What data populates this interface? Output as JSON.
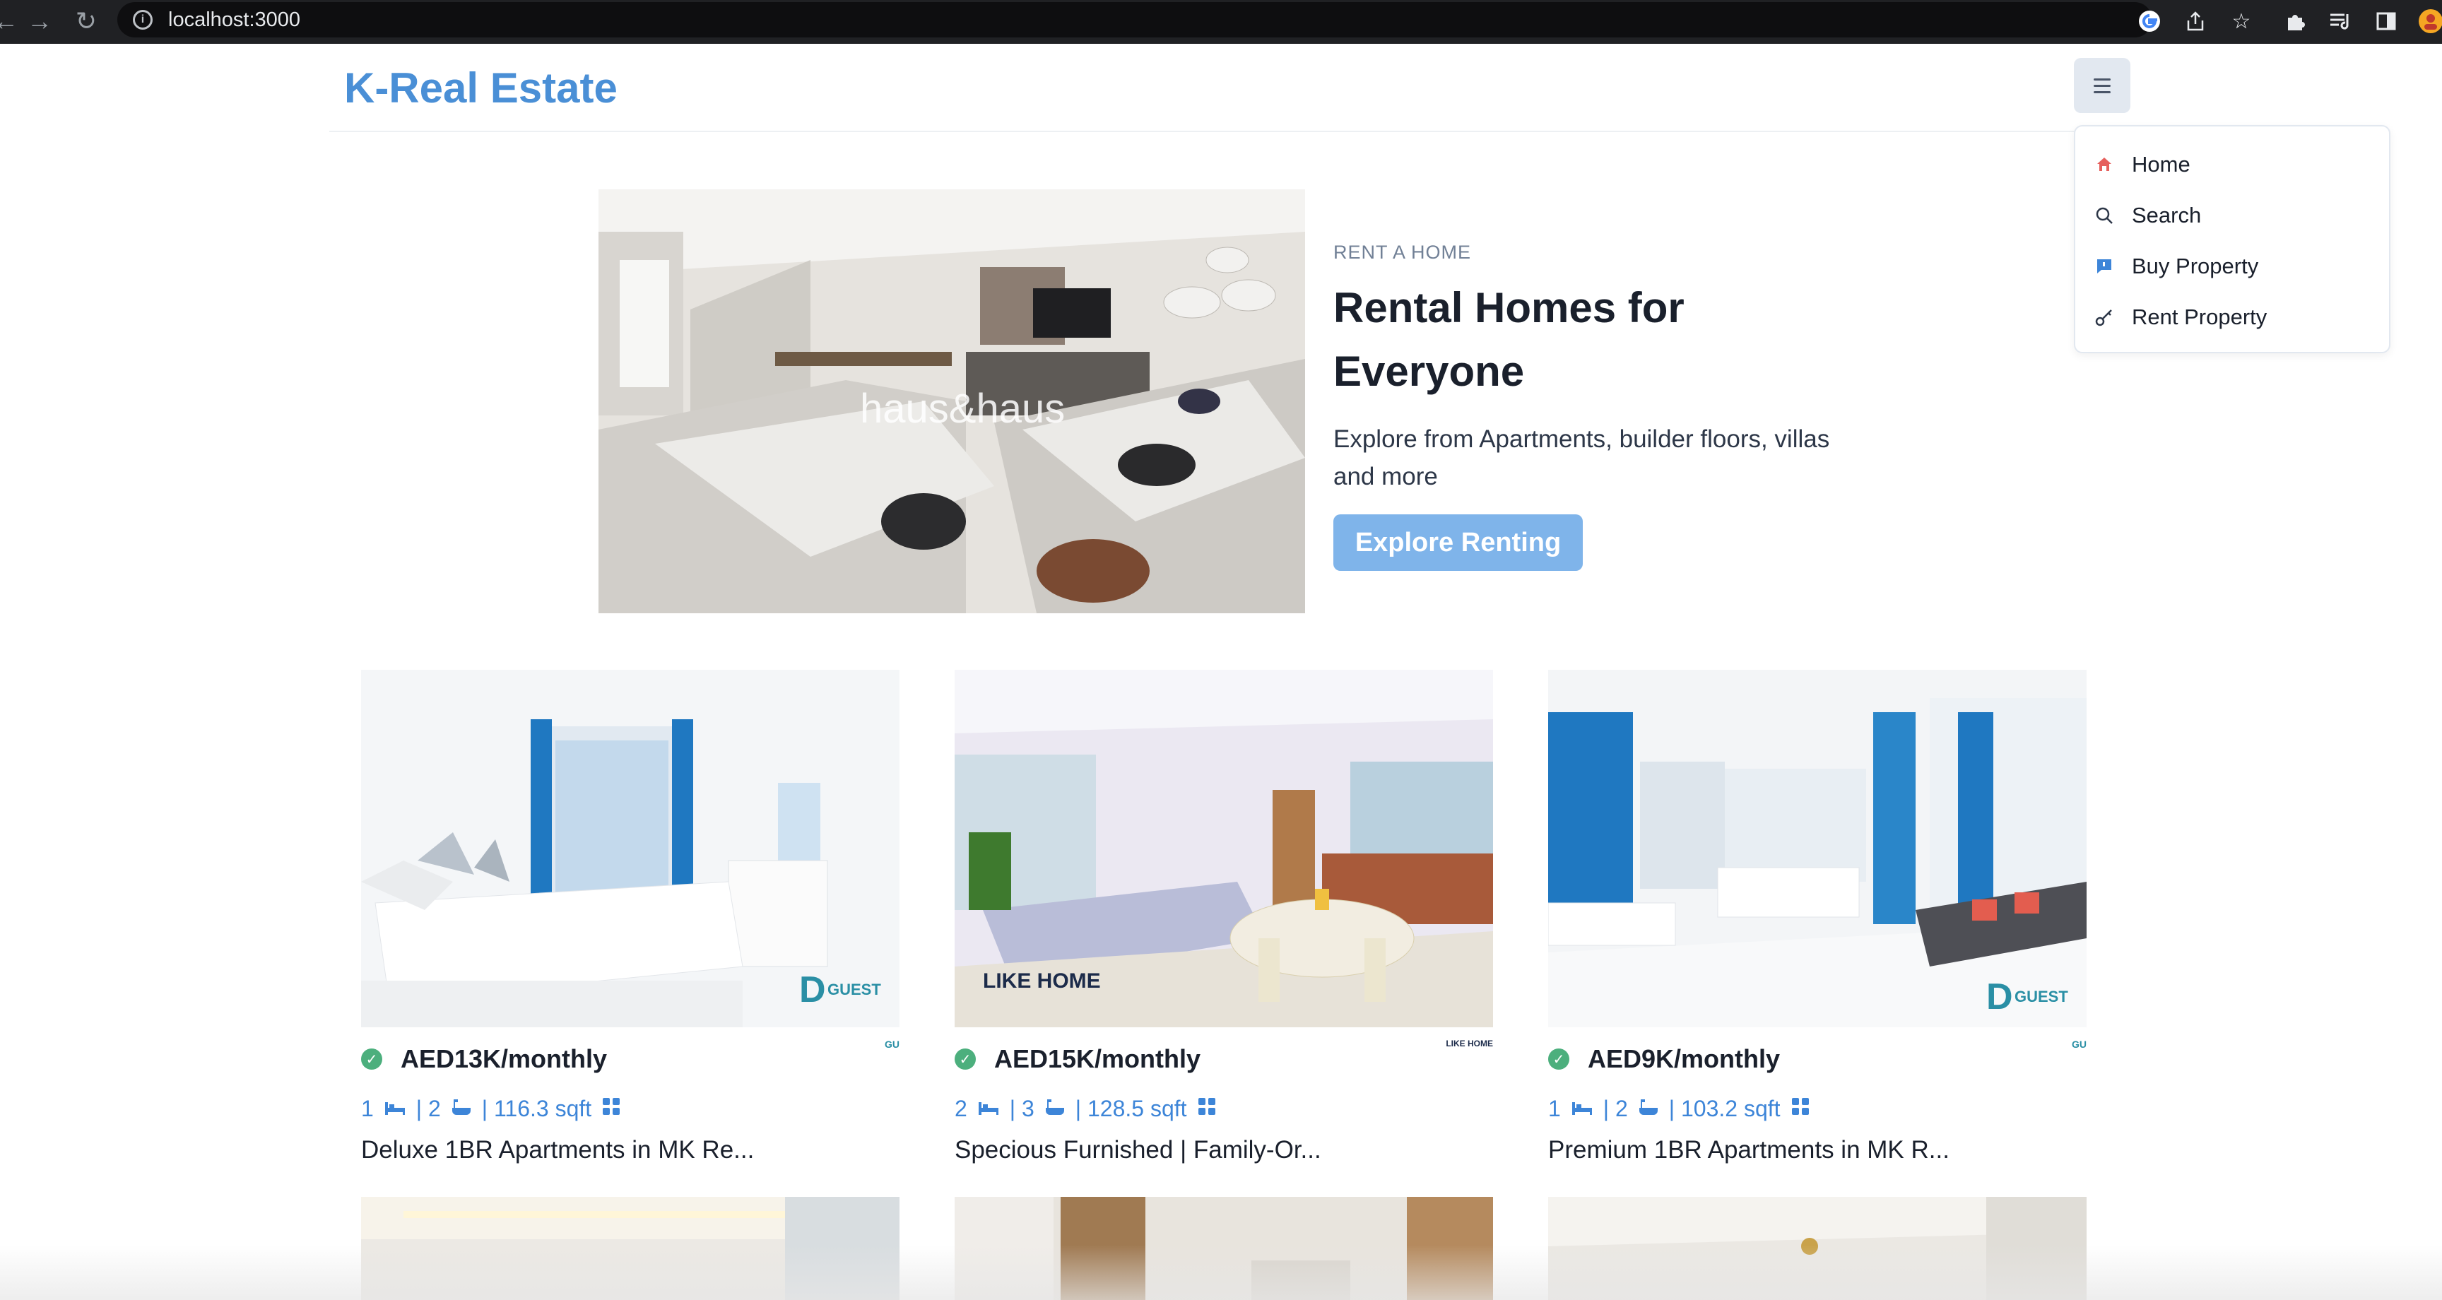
{
  "browser": {
    "url": "localhost:3000"
  },
  "brand": "K-Real Estate",
  "menu": {
    "items": [
      {
        "label": "Home",
        "icon": "home-icon"
      },
      {
        "label": "Search",
        "icon": "search-icon"
      },
      {
        "label": "Buy Property",
        "icon": "chat-icon"
      },
      {
        "label": "Rent Property",
        "icon": "key-icon"
      }
    ]
  },
  "hero": {
    "eyebrow": "RENT A HOME",
    "title_line1": "Rental Homes for",
    "title_line2": "Everyone",
    "description": "Explore from Apartments, builder floors, villas and more",
    "cta": "Explore Renting",
    "image_watermark": "haus&haus"
  },
  "listings": [
    {
      "price": "AED13K/monthly",
      "rooms": "1",
      "baths": "| 2",
      "area": "| 116.3 sqft",
      "title": "Deluxe 1BR Apartments in MK Re...",
      "agency": "GU"
    },
    {
      "price": "AED15K/monthly",
      "rooms": "2",
      "baths": "| 3",
      "area": "| 128.5 sqft",
      "title": "Specious Furnished | Family-Or...",
      "agency": "LIKE HOME"
    },
    {
      "price": "AED9K/monthly",
      "rooms": "1",
      "baths": "| 2",
      "area": "| 103.2 sqft",
      "title": "Premium 1BR Apartments in MK R...",
      "agency": "GU"
    }
  ],
  "colors": {
    "brand": "#4a8fd6",
    "cta": "#7fb4ea",
    "verified": "#4caf7d",
    "stats": "#3d85d8"
  }
}
